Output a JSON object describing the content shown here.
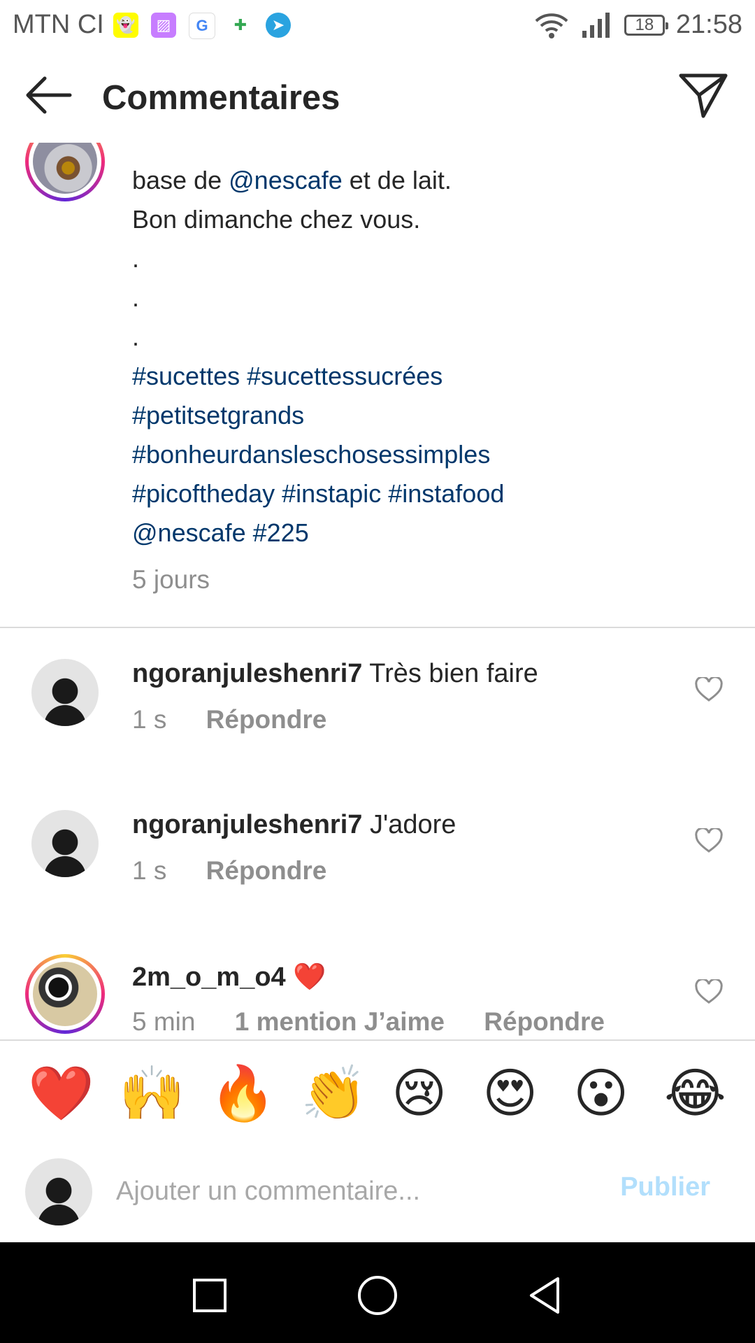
{
  "status_bar": {
    "carrier": "MTN CI",
    "battery": "18",
    "time": "21:58",
    "apps": [
      {
        "icon": "snapchat-icon",
        "glyph": "👻",
        "color": "#fffc00"
      },
      {
        "icon": "gallery-icon",
        "glyph": "▨",
        "color": "#c77dff"
      },
      {
        "icon": "google-icon",
        "glyph": "G",
        "color": "#ffffff"
      },
      {
        "icon": "puzzle-icon",
        "glyph": "✚",
        "color": "#ffffff"
      },
      {
        "icon": "telegram-icon",
        "glyph": "➤",
        "color": "#2aa3e0"
      }
    ]
  },
  "header": {
    "title": "Commentaires"
  },
  "caption": {
    "line_1": "base de ",
    "line_1_link": "@nescafe",
    "line_1_end": " et de lait.",
    "line_2": "Bon dimanche chez vous.",
    "dot": ".",
    "tags_1": "#sucettes #sucettessucrées",
    "tags_2": "#petitsetgrands",
    "tags_3": "#bonheurdansleschosessimples",
    "tags_4": "#picoftheday #instapic #instafood",
    "tags_5": "@nescafe #225",
    "time": "5 jours"
  },
  "comments": [
    {
      "user": "ngoranjuleshenri7",
      "text": "Très bien faire",
      "time": "1 s",
      "reply": "Répondre"
    },
    {
      "user": "ngoranjuleshenri7",
      "text": "J'adore",
      "time": "1 s",
      "reply": "Répondre"
    },
    {
      "user": "2m_o_m_o4",
      "text": "❤️",
      "time": "5 min",
      "likes": "1 mention J’aime",
      "reply": "Répondre"
    }
  ],
  "emoji_bar": [
    "❤️",
    "🙌",
    "🔥",
    "👏",
    "😢",
    "😍",
    "😮",
    "😂"
  ],
  "input": {
    "placeholder": "Ajouter un commentaire...",
    "publish": "Publier"
  },
  "colors": {
    "link": "#00376b",
    "muted": "#8e8e8e",
    "publish_disabled": "#b2dffc"
  }
}
